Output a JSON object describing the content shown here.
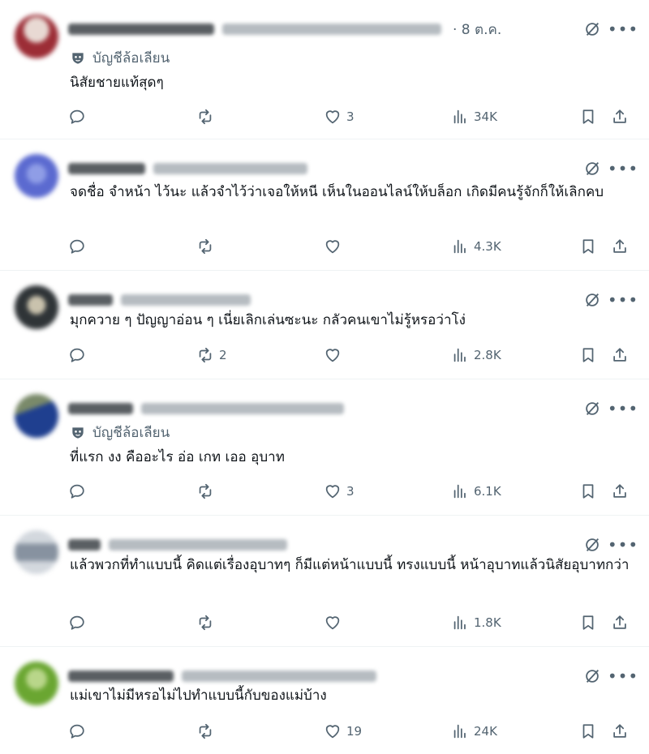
{
  "replies": [
    {
      "time": "· 8 ต.ค.",
      "label": "บัญชีล้อเลียน",
      "text": "นิสัยชายแท้สุดๆ",
      "reply_count": "",
      "repost_count": "",
      "like_count": "3",
      "views": "34K",
      "colors": {
        "avatar": "#9c2d36",
        "avatar2": "#e8d9d3"
      }
    },
    {
      "time": "",
      "label": "",
      "text": "จดชื่อ จำหน้า ไว้นะ แล้วจำไว้ว่าเจอให้หนี เห็นในออนไลน์ให้บล็อก เกิดมีคนรู้จักก็ให้เลิกคบ",
      "reply_count": "",
      "repost_count": "",
      "like_count": "",
      "views": "4.3K",
      "colors": {
        "avatar": "#5b6ad0",
        "avatar2": "#8f9de6"
      }
    },
    {
      "time": "",
      "label": "",
      "text": "มุกควาย ๆ ปัญญาอ่อน ๆ เนี่ยเลิกเล่นซะนะ กลัวคนเขาไม่รู้หรอว่าโง่",
      "reply_count": "",
      "repost_count": "2",
      "like_count": "",
      "views": "2.8K",
      "colors": {
        "avatar": "#2f3437",
        "avatar2": "#c9c2ad"
      }
    },
    {
      "time": "",
      "label": "บัญชีล้อเลียน",
      "text": "ที่แรก งง  คืออะไร  อ่อ เกท  เออ อุบาท",
      "reply_count": "",
      "repost_count": "",
      "like_count": "3",
      "views": "6.1K",
      "colors": {
        "avatar": "#1f3f8f",
        "avatar2": "#7a8a6a"
      }
    },
    {
      "time": "",
      "label": "",
      "text": "แล้วพวกที่ทำแบบนี้ คิดแต่เรื่องอุบาทๆ ก็มีแต่หน้าแบบนี้ ทรงแบบนี้ หน้าอุบาทแล้วนิสัยอุบาทกว่า",
      "reply_count": "",
      "repost_count": "",
      "like_count": "",
      "views": "1.8K",
      "colors": {
        "avatar": "#8792a0",
        "avatar2": "#d3d8de"
      }
    },
    {
      "time": "",
      "label": "",
      "text": "แม่เขาไม่มีหรอไม่ไปทำแบบนี้กับของแม่บ้าง",
      "reply_count": "",
      "repost_count": "",
      "like_count": "19",
      "views": "24K",
      "colors": {
        "avatar": "#6aa631",
        "avatar2": "#b9d68a"
      }
    }
  ]
}
